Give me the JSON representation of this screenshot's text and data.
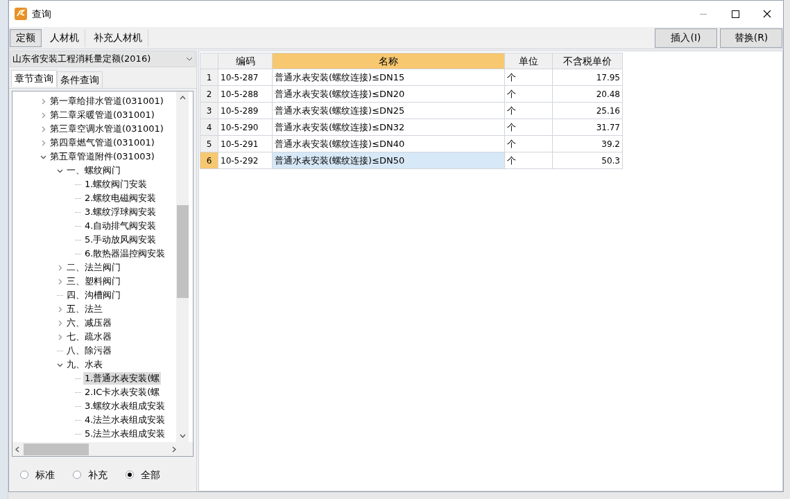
{
  "window": {
    "title": "查询"
  },
  "tabs": [
    {
      "label": "定额",
      "selected": true
    },
    {
      "label": "人材机",
      "selected": false
    },
    {
      "label": "补充人材机",
      "selected": false
    }
  ],
  "buttons": [
    "插入(I)",
    "替换(R)"
  ],
  "library": {
    "value": "山东省安装工程消耗量定额(2016)"
  },
  "subtabs": [
    {
      "label": "章节查询",
      "selected": true
    },
    {
      "label": "条件查询",
      "selected": false
    }
  ],
  "tree": [
    {
      "label": "第一章给排水管道(031001)",
      "expanded": false,
      "selected": false
    },
    {
      "label": "第二章采暖管道(031001)",
      "expanded": false,
      "selected": false
    },
    {
      "label": "第三章空调水管道(031001)",
      "expanded": false,
      "selected": false
    },
    {
      "label": "第四章燃气管道(031001)",
      "expanded": false,
      "selected": false
    },
    {
      "label": "第五章管道附件(031003)",
      "expanded": true,
      "selected": false,
      "children": [
        {
          "label": "一、螺纹阀门",
          "expanded": true,
          "selected": false,
          "children": [
            {
              "label": "1.螺纹阀门安装",
              "selected": false
            },
            {
              "label": "2.螺纹电磁阀安装",
              "selected": false
            },
            {
              "label": "3.螺纹浮球阀安装",
              "selected": false
            },
            {
              "label": "4.自动排气阀安装",
              "selected": false
            },
            {
              "label": "5.手动放风阀安装",
              "selected": false
            },
            {
              "label": "6.散热器温控阀安装",
              "selected": false
            }
          ]
        },
        {
          "label": "二、法兰阀门",
          "expanded": false,
          "selected": false
        },
        {
          "label": "三、塑料阀门",
          "expanded": false,
          "selected": false
        },
        {
          "label": "四、沟槽阀门",
          "selected": false
        },
        {
          "label": "五、法兰",
          "expanded": false,
          "selected": false
        },
        {
          "label": "六、减压器",
          "expanded": false,
          "selected": false
        },
        {
          "label": "七、疏水器",
          "expanded": false,
          "selected": false
        },
        {
          "label": "八、除污器",
          "selected": false
        },
        {
          "label": "九、水表",
          "expanded": true,
          "selected": false,
          "children": [
            {
              "label": "1.普通水表安装(螺",
              "selected": true
            },
            {
              "label": "2.IC卡水表安装(螺",
              "selected": false
            },
            {
              "label": "3.螺纹水表组成安装",
              "selected": false
            },
            {
              "label": "4.法兰水表组成安装",
              "selected": false
            },
            {
              "label": "5.法兰水表组成安装",
              "selected": false
            }
          ]
        }
      ]
    }
  ],
  "filters": [
    {
      "label": "标准",
      "selected": false
    },
    {
      "label": "补充",
      "selected": false
    },
    {
      "label": "全部",
      "selected": true
    }
  ],
  "table": {
    "columns": [
      {
        "label": "编码",
        "selected": false
      },
      {
        "label": "名称",
        "selected": true
      },
      {
        "label": "单位",
        "selected": false
      },
      {
        "label": "不含税单价",
        "selected": false
      }
    ],
    "rows": [
      {
        "number": "1",
        "cells": [
          "10-5-287",
          "普通水表安装(螺纹连接)≤DN15",
          "个",
          "17.95"
        ],
        "selected": false
      },
      {
        "number": "2",
        "cells": [
          "10-5-288",
          "普通水表安装(螺纹连接)≤DN20",
          "个",
          "20.48"
        ],
        "selected": false
      },
      {
        "number": "3",
        "cells": [
          "10-5-289",
          "普通水表安装(螺纹连接)≤DN25",
          "个",
          "25.16"
        ],
        "selected": false
      },
      {
        "number": "4",
        "cells": [
          "10-5-290",
          "普通水表安装(螺纹连接)≤DN32",
          "个",
          "31.77"
        ],
        "selected": false
      },
      {
        "number": "5",
        "cells": [
          "10-5-291",
          "普通水表安装(螺纹连接)≤DN40",
          "个",
          "39.2"
        ],
        "selected": false
      },
      {
        "number": "6",
        "cells": [
          "10-5-292",
          "普通水表安装(螺纹连接)≤DN50",
          "个",
          "50.3"
        ],
        "selected": true
      }
    ]
  }
}
